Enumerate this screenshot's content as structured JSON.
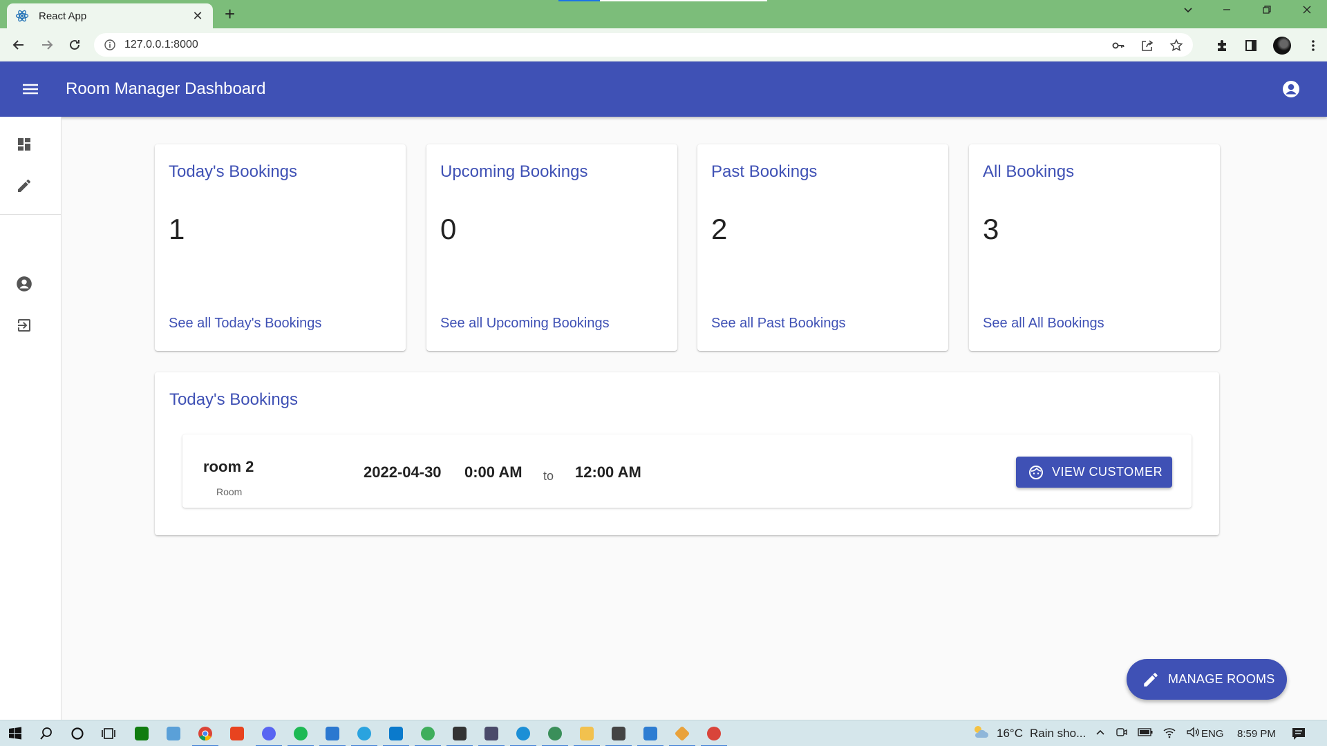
{
  "browser": {
    "tab_title": "React App",
    "url": "127.0.0.1:8000"
  },
  "appbar": {
    "title": "Room Manager Dashboard"
  },
  "stats": [
    {
      "title": "Today's Bookings",
      "count": "1",
      "link": "See all Today's Bookings"
    },
    {
      "title": "Upcoming Bookings",
      "count": "0",
      "link": "See all Upcoming Bookings"
    },
    {
      "title": "Past Bookings",
      "count": "2",
      "link": "See all Past Bookings"
    },
    {
      "title": "All Bookings",
      "count": "3",
      "link": "See all All Bookings"
    }
  ],
  "today": {
    "heading": "Today's Bookings",
    "bookings": [
      {
        "room": "room 2",
        "room_label": "Room",
        "date": "2022-04-30",
        "start": "0:00 AM",
        "separator": "to",
        "end": "12:00 AM",
        "button": "VIEW CUSTOMER"
      }
    ]
  },
  "fab": {
    "label": "MANAGE ROOMS"
  },
  "taskbar": {
    "weather": "16°C",
    "weather_text": "Rain sho...",
    "language": "ENG",
    "time": "8:59 PM"
  },
  "colors": {
    "primary": "#3f51b5",
    "browser_frame": "#7cbd7a"
  }
}
